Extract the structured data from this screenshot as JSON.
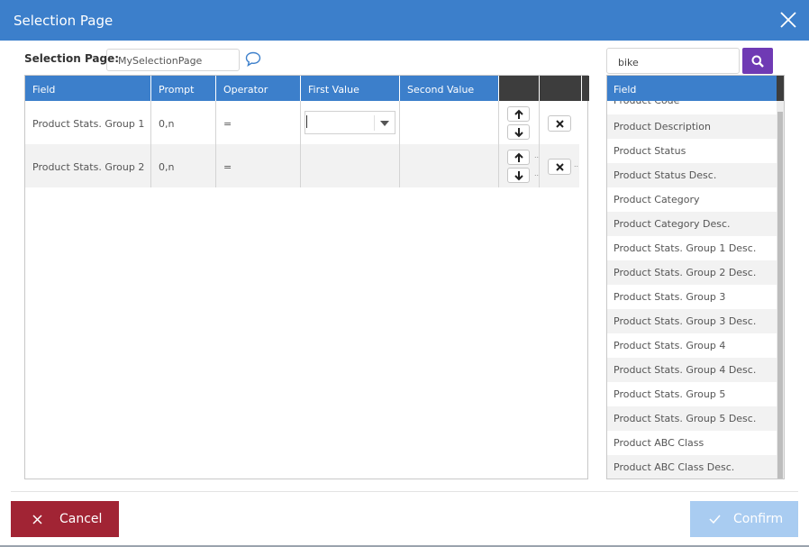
{
  "dialog": {
    "title": "Selection Page"
  },
  "selection": {
    "label": "Selection Page:",
    "value": "MySelectionPage"
  },
  "grid": {
    "columns": [
      "Field",
      "Prompt",
      "Operator",
      "First Value",
      "Second Value"
    ],
    "rows": [
      {
        "field": "Product Stats. Group 1",
        "prompt": "0,n",
        "operator": "="
      },
      {
        "field": "Product Stats. Group 2",
        "prompt": "0,n",
        "operator": "="
      }
    ]
  },
  "search": {
    "value": "bike"
  },
  "fields": {
    "header": "Field",
    "items": [
      "Product Code",
      "Product Description",
      "Product Status",
      "Product Status Desc.",
      "Product Category",
      "Product Category Desc.",
      "Product Stats. Group 1 Desc.",
      "Product Stats. Group 2 Desc.",
      "Product Stats. Group 3",
      "Product Stats. Group 3 Desc.",
      "Product Stats. Group 4",
      "Product Stats. Group 4 Desc.",
      "Product Stats. Group 5",
      "Product Stats. Group 5 Desc.",
      "Product ABC Class",
      "Product ABC Class Desc."
    ]
  },
  "footer": {
    "cancel_label": "Cancel",
    "confirm_label": "Confirm"
  },
  "colors": {
    "header_blue": "#3c7fcb",
    "cancel_red": "#a12434",
    "search_purple": "#6f3ab4",
    "confirm_disabled": "#a9ccf1"
  }
}
